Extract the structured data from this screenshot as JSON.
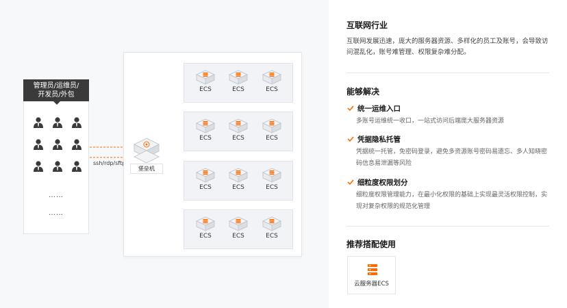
{
  "diagram": {
    "users_title": "管理员/运维员/开发员/外包",
    "users_title_line1": "管理员/运维员/",
    "users_title_line2": "开发员/外包",
    "ellipsis_1": "……",
    "ellipsis_2": "……",
    "protocol_label": "ssh/rdp/sftp",
    "bastion_label": "堡垒机",
    "ecs_label": "ECS",
    "groups": [
      {
        "items": [
          "ECS",
          "ECS",
          "ECS"
        ]
      },
      {
        "items": [
          "ECS",
          "ECS",
          "ECS"
        ]
      },
      {
        "items": [
          "ECS",
          "ECS",
          "ECS"
        ]
      },
      {
        "items": [
          "ECS",
          "ECS",
          "ECS"
        ]
      }
    ]
  },
  "industry": {
    "title": "互联网行业",
    "description": "互联网发展迅速，庞大的服务器资源、多样化的员工及账号，会导致访问混乱化，账号难管理、权限复杂难分配。"
  },
  "solution": {
    "title": "能够解决",
    "features": [
      {
        "title": "统一运维入口",
        "desc": "多账号运维统一收口，一站式访问后端庞大服务器资源"
      },
      {
        "title": "凭据隐私托管",
        "desc": "凭据统一托管，免密码登录，避免多资源账号密码易遗忘、多人知晓密码信息易泄漏等风险"
      },
      {
        "title": "细粒度权限划分",
        "desc": "细粒度权限管理能力，在最小化权限的基础上实现最灵活权限控制，实现对复杂权限的规范化管理"
      }
    ]
  },
  "recommend": {
    "title": "推荐搭配使用",
    "product": "云服务器ECS"
  },
  "colors": {
    "accent": "#ff6a00",
    "dark": "#3a3a3a",
    "line": "#b8bcc4"
  },
  "icons": {
    "user": "person-icon",
    "ecs": "server-icon",
    "check": "check-icon",
    "bastion": "bastion-host-icon"
  }
}
